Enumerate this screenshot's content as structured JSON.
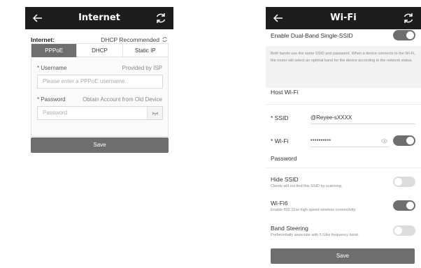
{
  "internet_screen": {
    "title": "Internet",
    "internet_label": "Internet:",
    "internet_value": "DHCP Recommended",
    "tabs": [
      {
        "label": "PPPoE",
        "active": true
      },
      {
        "label": "DHCP",
        "active": false
      },
      {
        "label": "Static IP",
        "active": false
      }
    ],
    "username": {
      "label": "* Username",
      "hint": "Provided by ISP",
      "placeholder": "Please enter a PPPoE username."
    },
    "password": {
      "label": "* Password",
      "hint": "Obtain Account from Old Device",
      "placeholder": "Password"
    },
    "save_label": "Save"
  },
  "wifi_screen": {
    "title": "Wi-Fi",
    "dual_band": {
      "label": "Enable Dual-Band Single-SSID",
      "on": true
    },
    "dual_band_desc": "Both bands use the same SSID and password. When a device connects to the Wi-Fi, the router will select an optimal band for the device according to the network status.",
    "host_wifi_label": "Host Wi-Fi",
    "ssid": {
      "label": "* SSID",
      "value": "@Reyee-sXXXX"
    },
    "wifi_password": {
      "label_line1": "* Wi-Fi",
      "label_line2": "Password",
      "value": "••••••••••",
      "on": true
    },
    "hide_ssid": {
      "label": "Hide SSID",
      "sub": "Clients will not find this SSID by scanning.",
      "on": false
    },
    "wifi6": {
      "label": "Wi-Fi6",
      "sub": "Enable 802.11ax high-speed wireless connectivity.",
      "on": true
    },
    "band_steering": {
      "label": "Band Steering",
      "sub": "Preferentially associate with 5 GHz frequency band.",
      "on": false
    },
    "save_label": "Save"
  },
  "colors": {
    "topbar": "#1d1d1d",
    "accent_gray": "#6e6e6e",
    "toggle_off": "#dcdcdc"
  }
}
